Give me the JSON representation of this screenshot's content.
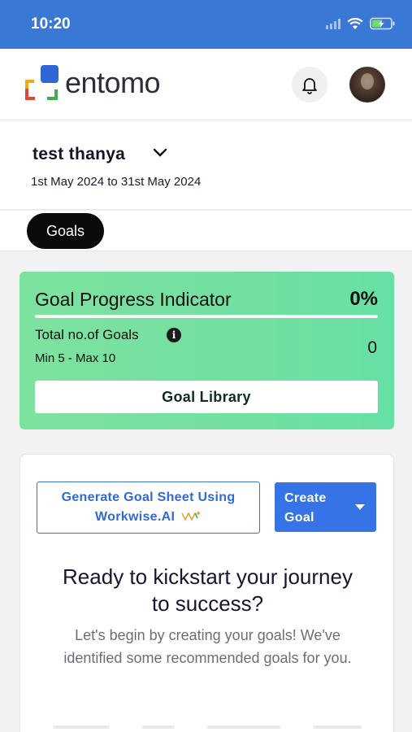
{
  "status_bar": {
    "time": "10:20"
  },
  "header": {
    "logo_text": "entomo",
    "logo_colors": [
      "#f2a81d",
      "#2f67d6",
      "#e1463a",
      "#3eab55"
    ],
    "notification_icon": "bell-icon",
    "avatar_icon": "user-avatar"
  },
  "user": {
    "name": "test thanya",
    "date_range": "1st May 2024 to 31st May 2024"
  },
  "tabs": [
    {
      "label": "Goals",
      "active": true
    }
  ],
  "progress_card": {
    "title": "Goal Progress Indicator",
    "percent": "0%",
    "progress_fraction": 0,
    "total_label": "Total no.of Goals",
    "min_max": "Min 5 - Max 10",
    "total_count": "0",
    "library_button": "Goal Library",
    "colors": {
      "start": "#7ee29f",
      "end": "#66e0a5"
    }
  },
  "goals_panel": {
    "workwise_line1": "Generate Goal Sheet Using",
    "workwise_line2": "Workwise.AI",
    "create_line1": "Create",
    "create_line2": "Goal",
    "headline_line1": "Ready to kickstart your journey",
    "headline_line2": "to success?",
    "subtext_line1": "Let's begin by creating your goals! We've",
    "subtext_line2": "identified some recommended goals for you."
  },
  "colors": {
    "status_bar": "#3a78d6",
    "primary": "#3573e6"
  }
}
